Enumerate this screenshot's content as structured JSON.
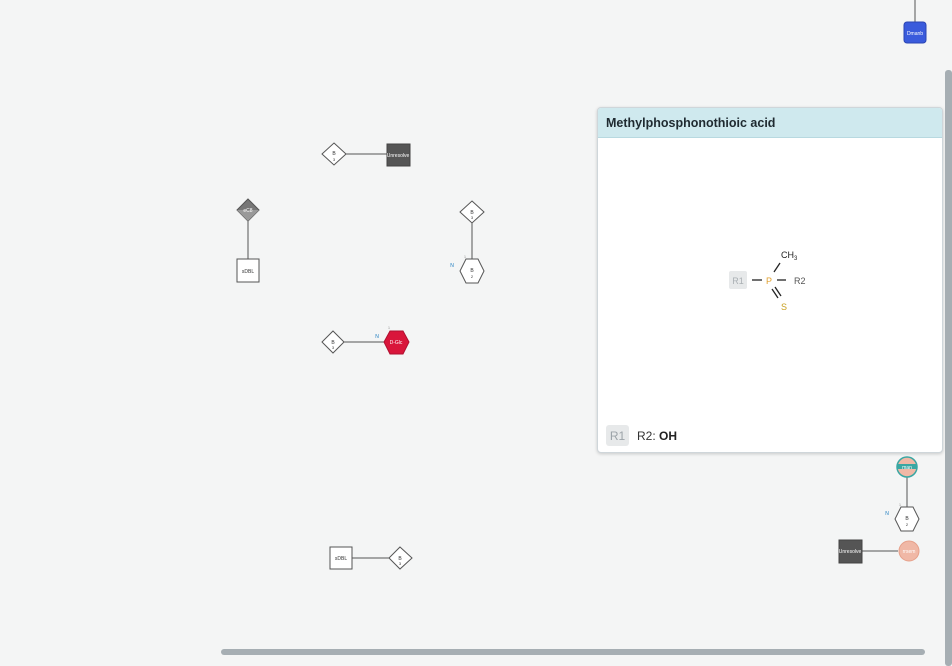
{
  "canvas": {
    "nodes": {
      "residue_top_right": "Dmanb",
      "unnamed_dark_top": "Unresolve",
      "diamond_b3_a": {
        "name": "B",
        "pos": "3"
      },
      "diamond_grey": "eC8",
      "square_left": "sDBL",
      "diamond_b3_b": {
        "name": "B",
        "pos": "3"
      },
      "hex_b2_a": {
        "name": "B",
        "pos": "2"
      },
      "hex_b2_a_N": "N",
      "hex_b2_a_one": "1",
      "diamond_b3_c": {
        "name": "B",
        "pos": "3"
      },
      "dglc_red": "D-Glc",
      "dglc_N": "N",
      "dglc_one": "1",
      "square_bottom": "sDBL",
      "diamond_b3_d": {
        "name": "B",
        "pos": "3"
      },
      "circle_teal": "man",
      "hex_b2_b": {
        "name": "B",
        "pos": "2"
      },
      "hex_b2_b_N": "N",
      "hex_b2_b_one": "1",
      "dark_bottom": "Unresolve",
      "circle_peach": "rrsem"
    }
  },
  "popup": {
    "title": "Methylphosphonothioic acid",
    "structure": {
      "r1": "R1",
      "p": "P",
      "r2": "R2",
      "s": "S",
      "ch": "CH",
      "sub3": "3"
    },
    "footer": {
      "r1_chip": "R1",
      "r2_label": "R2:",
      "r2_value": "OH"
    }
  },
  "colors": {
    "background": "#f4f5f5",
    "header_bg": "#cfe9ee",
    "blue_node": "#3a5bdc",
    "dark_node": "#555555",
    "red_node": "#d9163b",
    "teal_ring": "#3aa7a3",
    "peach_node": "#f0b8a6",
    "phosphorus": "#e0a030",
    "sulfur": "#c8a020"
  }
}
